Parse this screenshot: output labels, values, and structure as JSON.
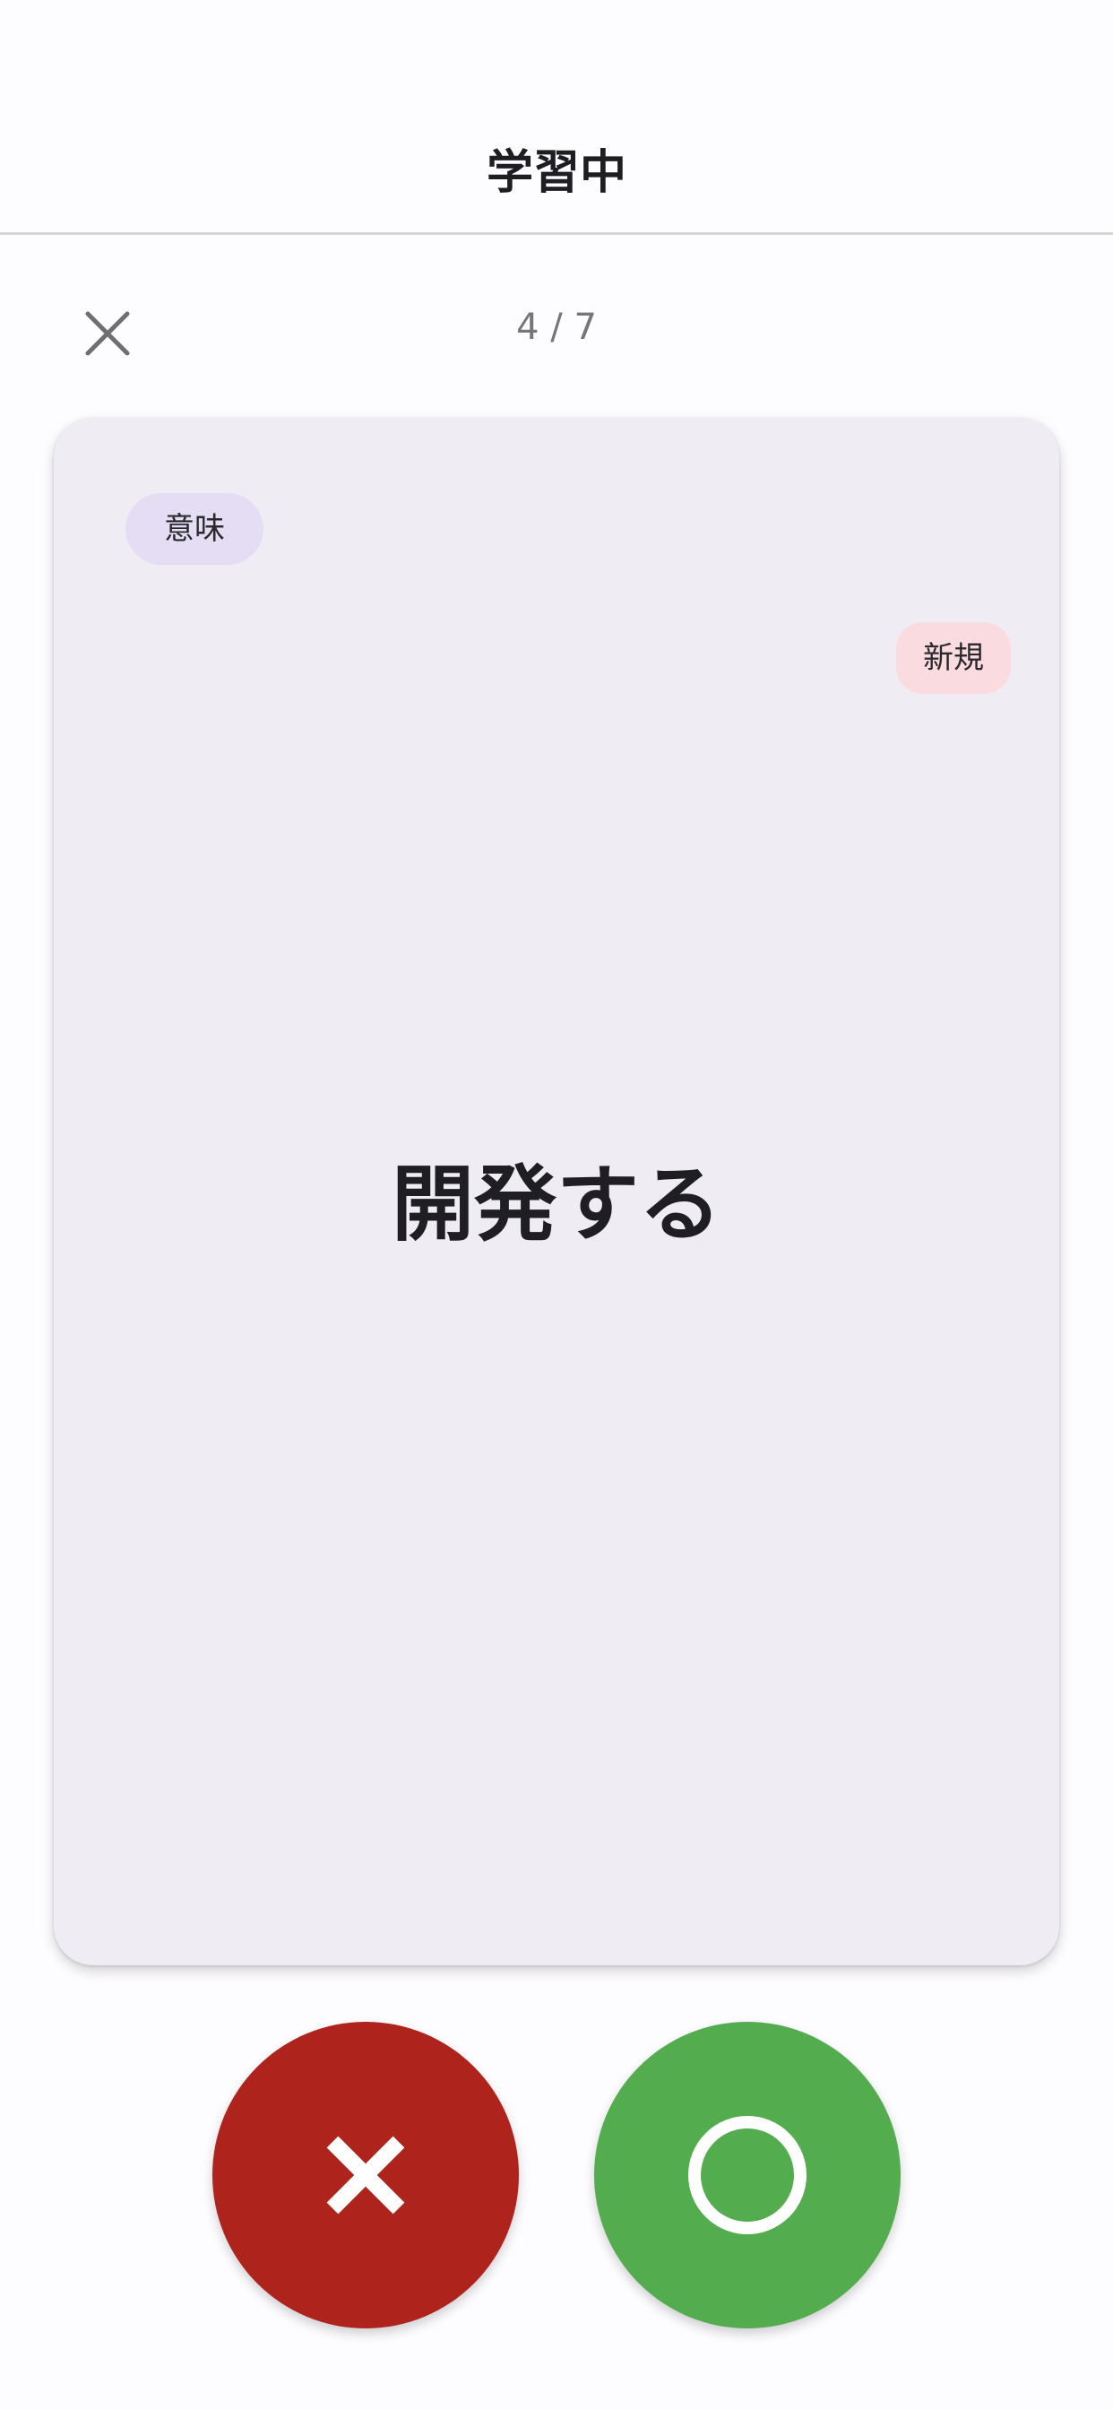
{
  "header": {
    "title": "学習中"
  },
  "session": {
    "progress": "4 / 7",
    "current": 4,
    "total": 7
  },
  "card": {
    "type_label": "意味",
    "status_label": "新規",
    "term": "開発する"
  },
  "icons": {
    "close": "close-icon",
    "wrong": "cross-icon",
    "correct": "circle-icon"
  },
  "colors": {
    "wrong_button": "#ae241d",
    "correct_button": "#53ad4f",
    "type_chip": "#e5ddf3",
    "status_chip": "#fadbdf",
    "card_background": "#efedf3"
  }
}
